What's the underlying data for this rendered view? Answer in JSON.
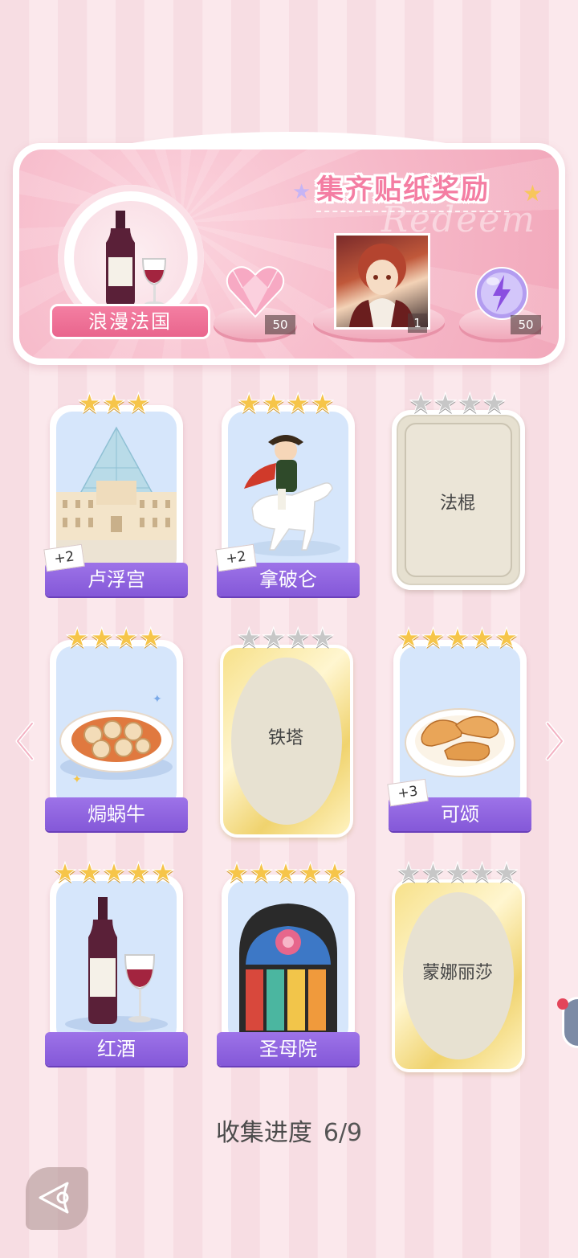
{
  "reward_panel": {
    "title": "集齐贴纸奖励",
    "script_text": "Redeem",
    "theme_name": "浪漫法国",
    "rewards": [
      {
        "item": "pink-heart-gem",
        "count": "50"
      },
      {
        "item": "character-portrait",
        "count": "1"
      },
      {
        "item": "purple-energy-orb",
        "count": "50"
      }
    ]
  },
  "cards": [
    {
      "name": "卢浮宫",
      "stars": 3,
      "collected": true,
      "bonus": "+2",
      "art": "louvre-pyramid"
    },
    {
      "name": "拿破仑",
      "stars": 4,
      "collected": true,
      "bonus": "+2",
      "art": "napoleon-on-horse"
    },
    {
      "name": "法棍",
      "stars": 4,
      "collected": false,
      "bonus": "",
      "art": "locked-frame"
    },
    {
      "name": "焗蜗牛",
      "stars": 4,
      "collected": true,
      "bonus": "",
      "art": "escargot-dish"
    },
    {
      "name": "铁塔",
      "stars": 4,
      "collected": false,
      "bonus": "",
      "art": "locked-oval"
    },
    {
      "name": "可颂",
      "stars": 5,
      "collected": true,
      "bonus": "+3",
      "art": "croissant-plate"
    },
    {
      "name": "红酒",
      "stars": 5,
      "collected": true,
      "bonus": "",
      "art": "red-wine"
    },
    {
      "name": "圣母院",
      "stars": 5,
      "collected": true,
      "bonus": "",
      "art": "rose-window"
    },
    {
      "name": "蒙娜丽莎",
      "stars": 5,
      "collected": false,
      "bonus": "",
      "art": "locked-oval"
    }
  ],
  "progress": {
    "label": "收集进度",
    "value": "6/9"
  },
  "colors": {
    "ribbon": "#8a5ddb",
    "accent_pink": "#f47ea3",
    "star_gold": "#f6c549",
    "star_gray": "#c7c7c7"
  }
}
